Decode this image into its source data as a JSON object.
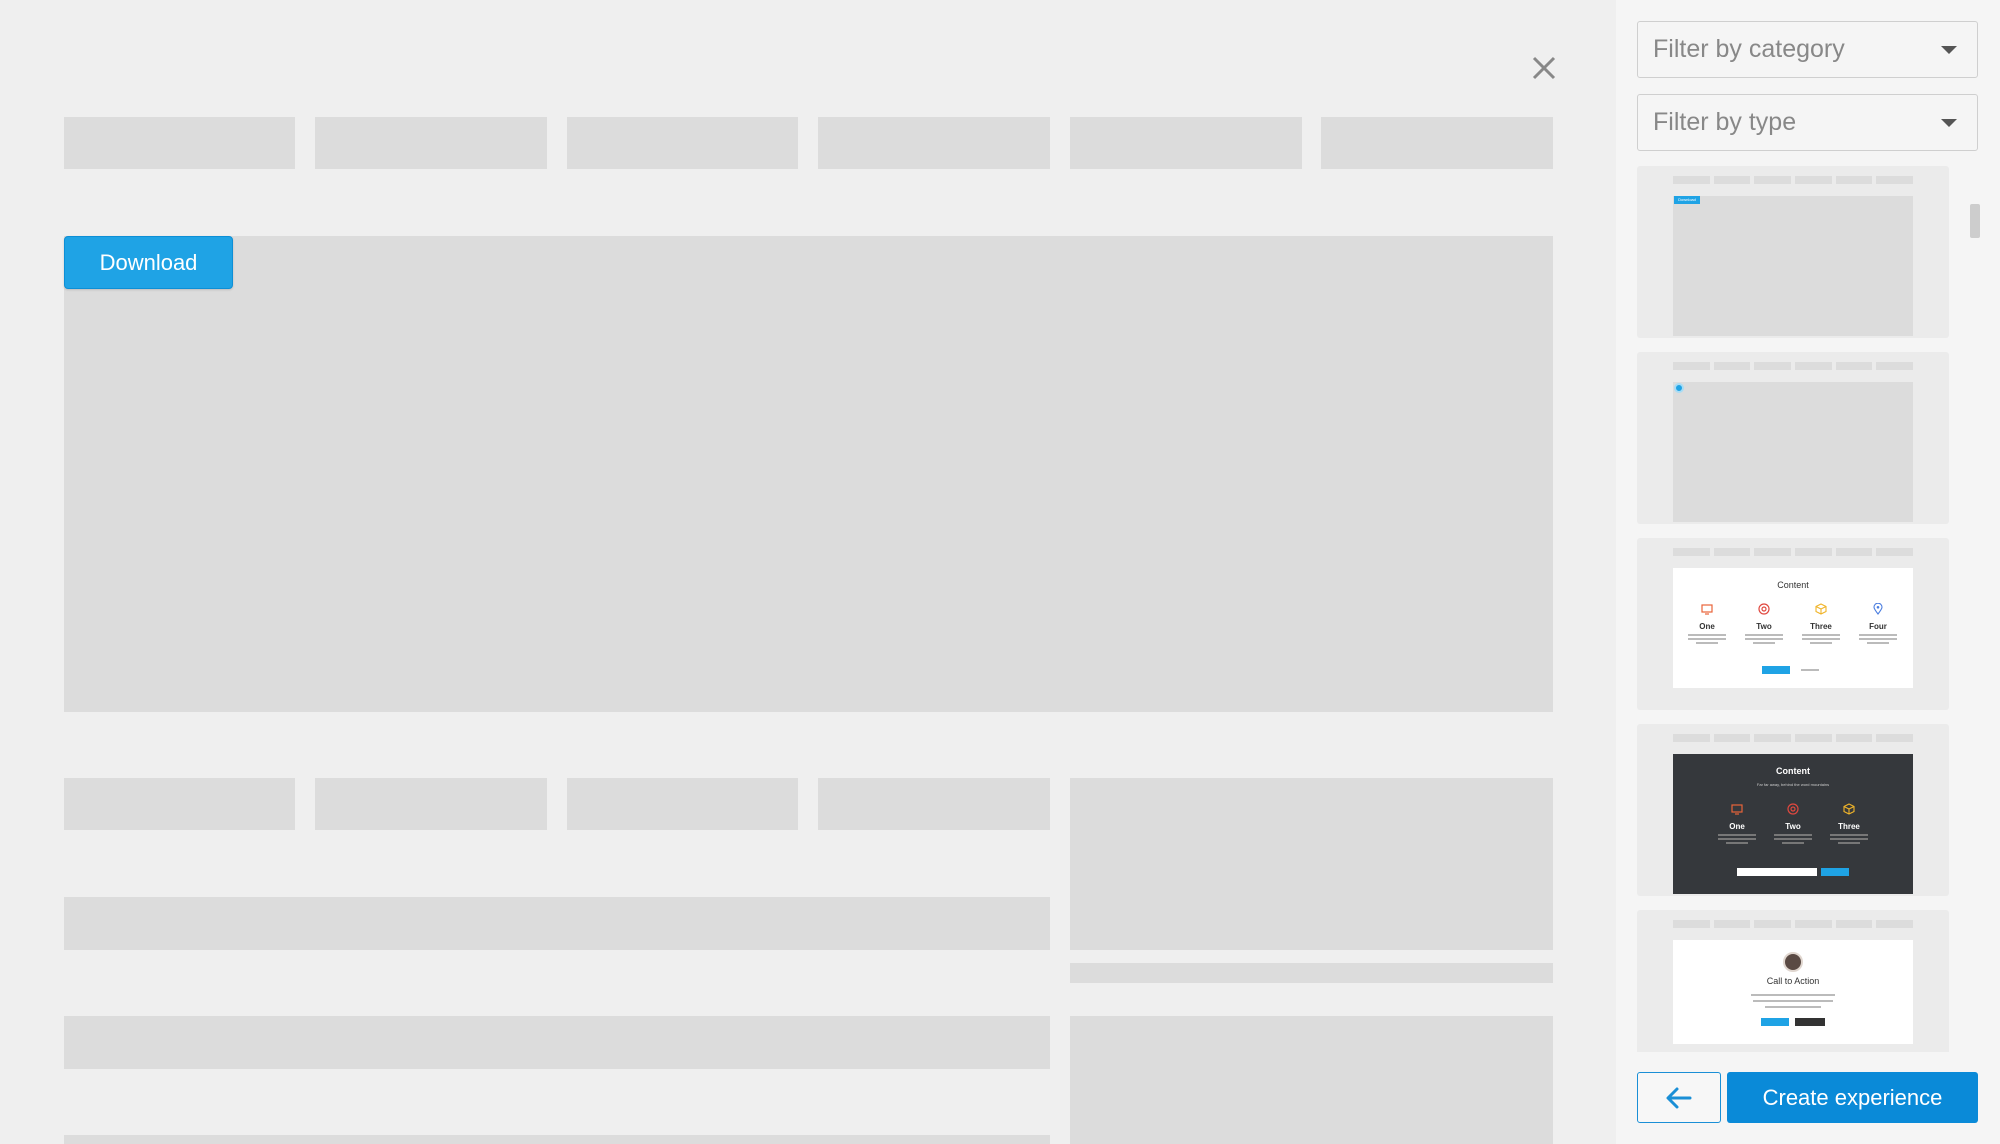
{
  "main": {
    "download_label": "Download"
  },
  "sidebar": {
    "filter_category_placeholder": "Filter by category",
    "filter_type_placeholder": "Filter by type",
    "create_label": "Create experience",
    "templates": [
      {
        "name": "template-download-bar",
        "badge": "Download"
      },
      {
        "name": "template-beacon"
      },
      {
        "name": "template-content-four",
        "heading": "Content",
        "columns": [
          "One",
          "Two",
          "Three",
          "Four"
        ]
      },
      {
        "name": "template-content-dark",
        "heading": "Content",
        "subheading": "Far far away, behind the word mountains",
        "columns": [
          "One",
          "Two",
          "Three"
        ]
      },
      {
        "name": "template-call-to-action",
        "heading": "Call to Action"
      }
    ]
  },
  "colors": {
    "accent": "#1fa3e5",
    "primary_button": "#0a8ad8",
    "placeholder": "#dcdcdc",
    "background": "#efefef",
    "dark_card": "#35383c",
    "icon_orange": "#e8633a",
    "icon_red": "#e0483f",
    "icon_yellow": "#f0b429",
    "icon_blue": "#4a7de0"
  }
}
